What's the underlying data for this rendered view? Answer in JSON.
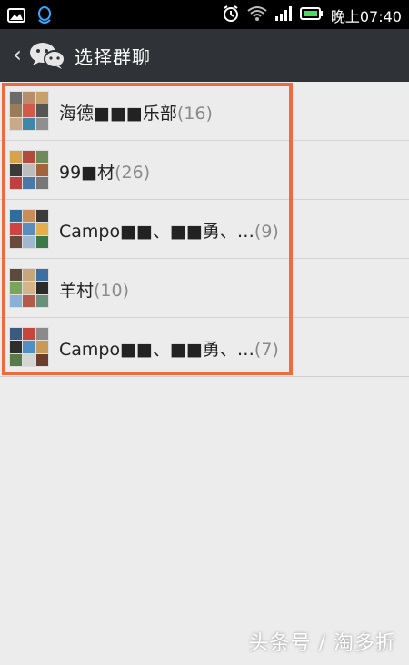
{
  "status": {
    "time": "晚上07:40",
    "icons": [
      "image-icon",
      "qq-icon",
      "alarm-icon",
      "wifi-icon",
      "signal-icon",
      "battery-icon"
    ],
    "battery_color": "#4cd964"
  },
  "nav": {
    "back_glyph": "‹",
    "title": "选择群聊"
  },
  "groups": [
    {
      "name": "海德■■■乐部",
      "count": "(16)"
    },
    {
      "name": "99■材",
      "count": "(26)"
    },
    {
      "name": "Campo■■、■■勇、…",
      "count": "(9)"
    },
    {
      "name": "羊村",
      "count": "(10)"
    },
    {
      "name": "Campo■■、■■勇、…",
      "count": "(7)"
    }
  ],
  "watermark": "头条号 / 淘多折",
  "colors": {
    "highlight": "#ee6a40",
    "navbar": "#2f3237",
    "background": "#ececec"
  }
}
